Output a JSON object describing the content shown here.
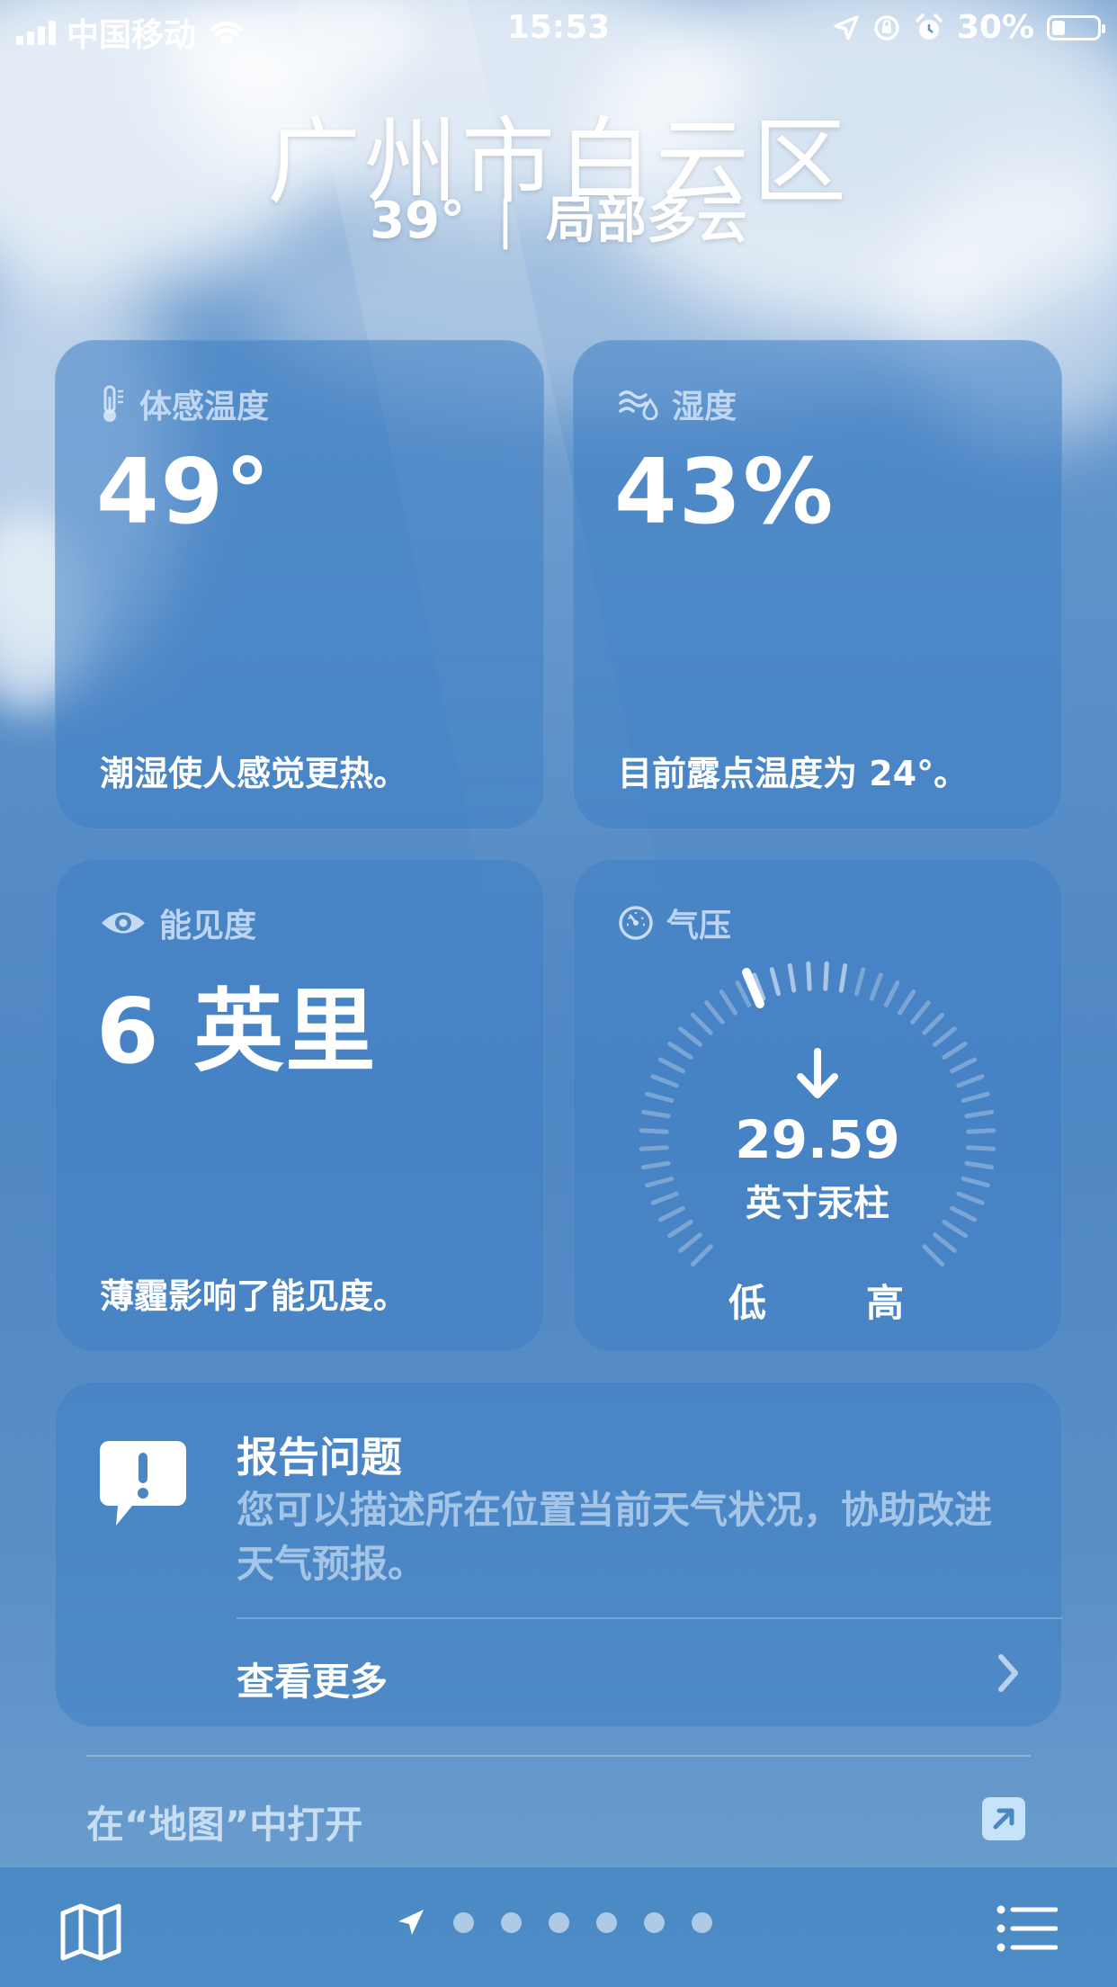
{
  "status_bar": {
    "carrier": "中国移动",
    "time": "15:53",
    "battery": "30%"
  },
  "header": {
    "location": "广州市白云区",
    "temperature": "39°",
    "separator": "|",
    "condition": "局部多云"
  },
  "feels_like": {
    "title": "体感温度",
    "value": "49°",
    "note": "潮湿使人感觉更热。",
    "icon": "thermometer-icon"
  },
  "humidity": {
    "title": "湿度",
    "value": "43%",
    "note": "目前露点温度为 24°。",
    "icon": "humidity-icon"
  },
  "visibility": {
    "title": "能见度",
    "value": "6 英里",
    "note": "薄霾影响了能见度。",
    "icon": "eye-icon"
  },
  "pressure": {
    "title": "气压",
    "value": "29.59",
    "unit": "英寸汞柱",
    "low_label": "低",
    "high_label": "高",
    "trend": "falling",
    "icon": "gauge-icon"
  },
  "report": {
    "title": "报告问题",
    "description": "您可以描述所在位置当前天气状况，协助改进天气预报。",
    "more": "查看更多",
    "icon": "exclamation-bubble-icon"
  },
  "map_link": {
    "label": "在“地图”中打开",
    "icon": "external-link-icon"
  },
  "tab_bar": {
    "page_dots": 6,
    "current": "location-arrow-icon",
    "left_icon": "map-icon",
    "right_icon": "list-icon"
  }
}
